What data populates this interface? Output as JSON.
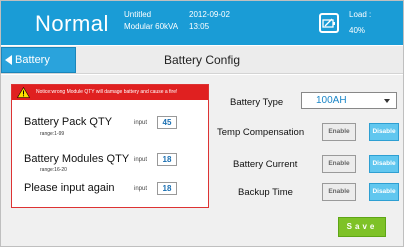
{
  "header": {
    "mode": "Normal",
    "model_line1": "Untitled",
    "model_line2": "Modular 60kVA",
    "date": "2012-09-02",
    "time": "13:05",
    "status_icon": "battery-status-icon",
    "load_label": "Load :",
    "load_value": "40%"
  },
  "nav": {
    "back_label": "Battery",
    "title": "Battery Config"
  },
  "dialog": {
    "warning": "Notice:wrong Module QTY will damage battery and cause a fire!",
    "rows": [
      {
        "label": "Battery Pack QTY",
        "range": "range:1-99",
        "input_label": "input",
        "value": "45"
      },
      {
        "label": "Battery Modules QTY",
        "range": "range:16-20",
        "input_label": "input",
        "value": "18"
      },
      {
        "label": "Please input again",
        "range": "",
        "input_label": "input",
        "value": "18"
      }
    ]
  },
  "config": {
    "battery_type_label": "Battery Type",
    "battery_type_value": "100AH",
    "temp_comp_label": "Temp Compensation",
    "battery_current_label": "Battery Current",
    "backup_time_label": "Backup Time",
    "enable_label": "Enable",
    "disable_label": "Disable",
    "save_label": "Save"
  },
  "colors": {
    "header_blue": "#1a9cd6",
    "warning_red": "#e02020",
    "disable_blue": "#61c7ef",
    "save_green": "#7ec227"
  }
}
